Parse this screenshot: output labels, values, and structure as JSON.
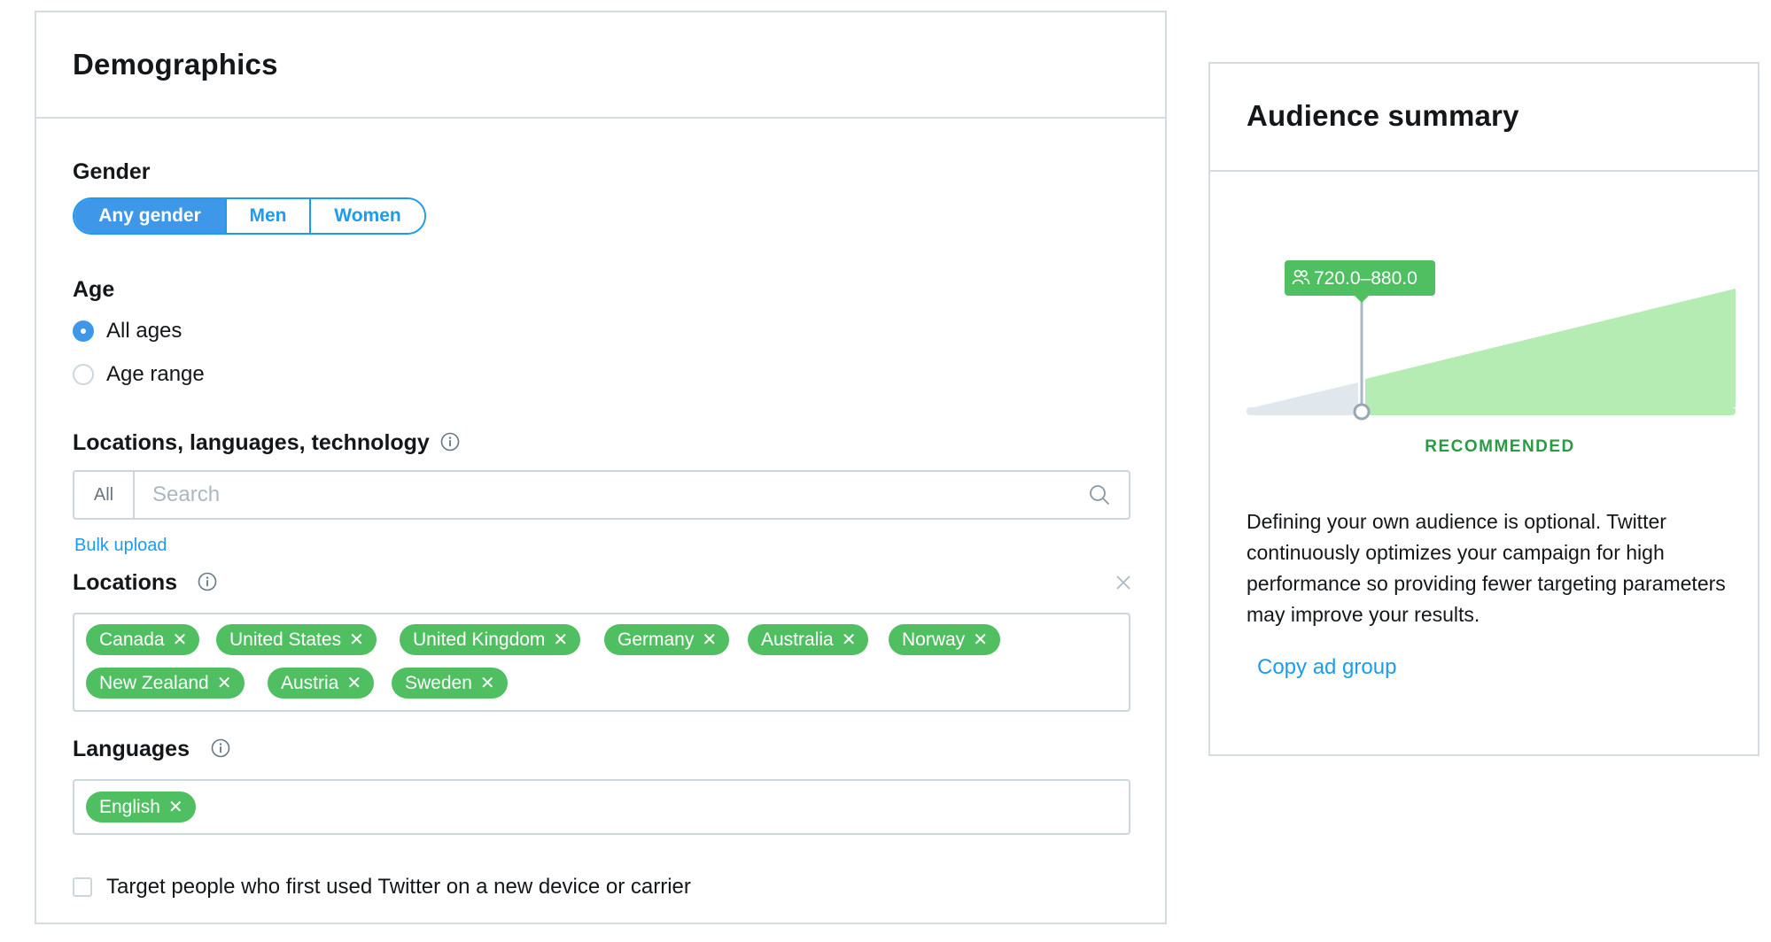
{
  "demographics": {
    "title": "Demographics",
    "gender": {
      "label": "Gender",
      "options": [
        "Any gender",
        "Men",
        "Women"
      ],
      "selected": "Any gender"
    },
    "age": {
      "label": "Age",
      "options": [
        "All ages",
        "Age range"
      ],
      "selected": "All ages"
    },
    "llt": {
      "label": "Locations, languages, technology",
      "search_scope": "All",
      "search_placeholder": "Search",
      "bulk_upload": "Bulk upload"
    },
    "locations": {
      "label": "Locations",
      "tags": [
        "Canada",
        "United States",
        "United Kingdom",
        "Germany",
        "Australia",
        "Norway",
        "New Zealand",
        "Austria",
        "Sweden"
      ]
    },
    "languages": {
      "label": "Languages",
      "tags": [
        "English"
      ]
    },
    "device_checkbox": {
      "label": "Target people who first used Twitter on a new device or carrier",
      "checked": false
    }
  },
  "audience_summary": {
    "title": "Audience summary",
    "estimate_label": "720.0–880.0",
    "recommended_label": "RECOMMENDED",
    "description": "Defining your own audience is optional. Twitter continuously optimizes your campaign for high performance so providing fewer targeting parameters may improve your results.",
    "copy_link": "Copy ad group"
  },
  "colors": {
    "accent": "#1d9bf0",
    "tag_green": "#4fbf62",
    "recommended_green": "#2b9a45",
    "chart_fill": "#b5ecb3",
    "border": "#d5dbe0"
  }
}
